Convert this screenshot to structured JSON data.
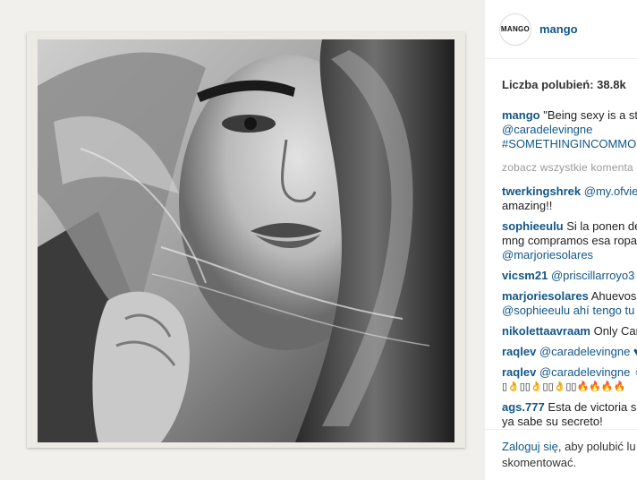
{
  "post": {
    "username": "mango",
    "avatar_text": "MANGO",
    "likes_text": "Liczba polubień: 38.8k"
  },
  "caption": {
    "user": "mango",
    "line1": "\"Being sexy is a st",
    "line2": "@caradelevingne",
    "line3": "#SOMETHINGINCOMMON"
  },
  "view_all_comments": "zobacz wszystkie komenta",
  "comments": [
    {
      "user": "twerkingshrek",
      "lines": [
        "@my.ofview",
        "amazing!!"
      ]
    },
    {
      "user": "sophieeulu",
      "lines": [
        "Si la ponen de",
        "mng compramos esa ropa",
        "@marjoriesolares"
      ]
    },
    {
      "user": "vicsm21",
      "lines": [
        "@priscillarroyo3"
      ]
    },
    {
      "user": "marjoriesolares",
      "lines": [
        "Ahuevos",
        "@sophieeulu ahí tengo tu"
      ]
    },
    {
      "user": "nikolettaavraam",
      "lines": [
        "Only Car"
      ]
    },
    {
      "user": "raqlev",
      "lines": [
        "@caradelevingne ♥"
      ]
    },
    {
      "user": "raqlev",
      "lines": [
        "@caradelevingne ☺",
        "▯👌▯▯👌▯▯👌▯▯🔥🔥🔥🔥"
      ]
    },
    {
      "user": "ags.777",
      "lines": [
        "Esta de victoria se",
        "ya sabe su secreto!"
      ]
    }
  ],
  "footer": {
    "login_link": "Zaloguj się",
    "login_rest_1": ", aby polubić lu",
    "login_rest_2": "skomentować."
  },
  "colors": {
    "link_blue": "#125688",
    "muted_gray": "#999999",
    "photo_background": "#f1f0ec"
  }
}
